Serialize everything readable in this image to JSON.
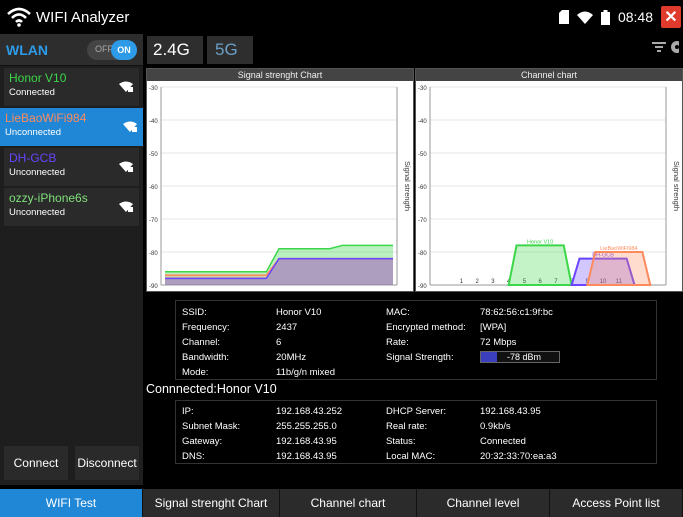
{
  "app": {
    "title": "WIFI Analyzer",
    "time": "08:48",
    "close_glyph": "✕"
  },
  "sidebar": {
    "wlan_label": "WLAN",
    "toggle_off": "OFF",
    "toggle_on": "ON",
    "networks": [
      {
        "name": "Honor V10",
        "state": "Connected",
        "color": "#3cd64a"
      },
      {
        "name": "LieBaoWiFi984",
        "state": "Unconnected",
        "color": "#ff8a5c"
      },
      {
        "name": "DH-GCB",
        "state": "Unconnected",
        "color": "#6a44ff"
      },
      {
        "name": "ozzy-iPhone6s",
        "state": "Unconnected",
        "color": "#7fe07a"
      }
    ],
    "connect_label": "Connect",
    "disconnect_label": "Disconnect"
  },
  "band_tabs": {
    "active": "2.4G",
    "other": "5G"
  },
  "signal_chart": {
    "title": "Signal strenght Chart",
    "ylabel": "Signal strength"
  },
  "channel_chart": {
    "title": "Channel chart",
    "ylabel": "Signal strength"
  },
  "chart_data": [
    {
      "type": "area",
      "title": "Signal strenght Chart",
      "ylabel": "Signal strength",
      "yticks": [
        "-30",
        "-40",
        "-50",
        "-60",
        "-70",
        "-80",
        "-90"
      ],
      "ylim": [
        -90,
        -30
      ],
      "series": [
        {
          "name": "Honor V10",
          "color": "#3cd64a",
          "values": [
            -86,
            -86,
            -86,
            -86,
            -86,
            -86,
            -86,
            -86,
            -86,
            -79,
            -79,
            -79,
            -79,
            -79,
            -78,
            -78,
            -78,
            -78,
            -78
          ]
        },
        {
          "name": "LieBaoWiFi984",
          "color": "#ff8a5c",
          "values": [
            -87,
            -87,
            -87,
            -87,
            -87,
            -87,
            -87,
            -87,
            -87,
            -82,
            -82,
            -82,
            -82,
            -82,
            -82,
            -82,
            -82,
            -82,
            -82
          ]
        },
        {
          "name": "DH-GCB",
          "color": "#6a44ff",
          "values": [
            -88,
            -88,
            -88,
            -88,
            -88,
            -88,
            -88,
            -88,
            -88,
            -82,
            -82,
            -82,
            -82,
            -82,
            -82,
            -82,
            -82,
            -82,
            -82
          ]
        }
      ]
    },
    {
      "type": "area",
      "title": "Channel chart",
      "ylabel": "Signal strength",
      "yticks": [
        "-30",
        "-40",
        "-50",
        "-60",
        "-70",
        "-80",
        "-90"
      ],
      "xticks": [
        "1",
        "2",
        "3",
        "4",
        "5",
        "6",
        "7",
        "8",
        "9",
        "10",
        "11"
      ],
      "ylim": [
        -90,
        -30
      ],
      "xlim": [
        -1,
        14
      ],
      "series": [
        {
          "name": "Honor V10",
          "color": "#3cd64a",
          "channel": 6,
          "signal": -78
        },
        {
          "name": "DH-GCB",
          "color": "#6a44ff",
          "channel": 10,
          "signal": -82
        },
        {
          "name": "LieBaoWiFi984",
          "color": "#ff8a5c",
          "channel": 11,
          "signal": -80
        }
      ]
    }
  ],
  "details": {
    "ssid_label": "SSID:",
    "ssid": "Honor V10",
    "freq_label": "Frequency:",
    "freq": "2437",
    "channel_label": "Channel:",
    "channel": "6",
    "bw_label": "Bandwidth:",
    "bw": "20MHz",
    "mode_label": "Mode:",
    "mode": "11b/g/n mixed",
    "mac_label": "MAC:",
    "mac": "78:62:56:c1:9f:bc",
    "enc_label": "Encrypted method:",
    "enc": "[WPA]",
    "rate_label": "Rate:",
    "rate": "72 Mbps",
    "sig_label": "Signal Strength:",
    "sig": "-78 dBm",
    "sig_level": 0.2
  },
  "connected": {
    "title": "Connnected:Honor V10",
    "ip_label": "IP:",
    "ip": "192.168.43.252",
    "mask_label": "Subnet Mask:",
    "mask": "255.255.255.0",
    "gw_label": "Gateway:",
    "gw": "192.168.43.95",
    "dns_label": "DNS:",
    "dns": "192.168.43.95",
    "dhcp_label": "DHCP Server:",
    "dhcp": "192.168.43.95",
    "realrate_label": "Real rate:",
    "realrate": "0.9kb/s",
    "status_label": "Status:",
    "status": "Connected",
    "localmac_label": "Local MAC:",
    "localmac": "20:32:33:70:ea:a3"
  },
  "bottom_nav": [
    "WIFI Test",
    "Signal strenght Chart",
    "Channel chart",
    "Channel level",
    "Access Point list"
  ]
}
